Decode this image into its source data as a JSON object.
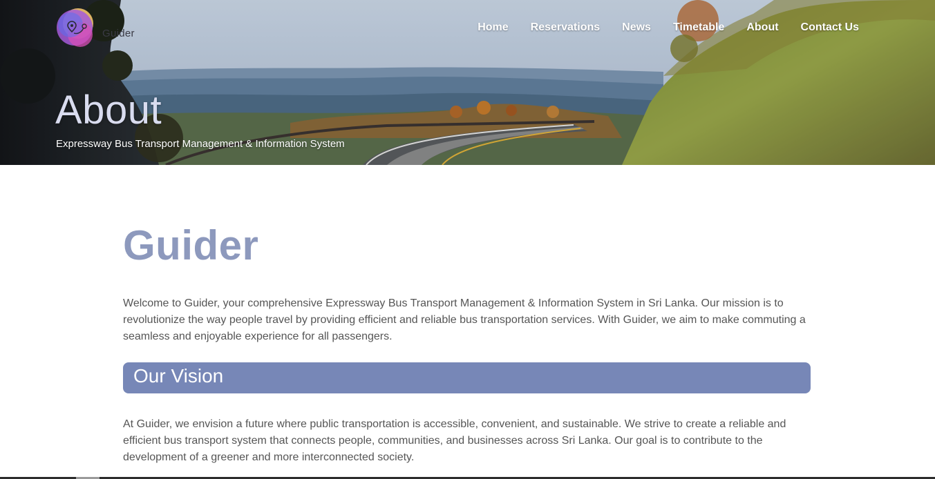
{
  "brand": {
    "logo_text": "Guider",
    "colors": {
      "heading": "#8d99bd",
      "vision_bar": "#7787b7",
      "body_text": "#555555"
    }
  },
  "nav": {
    "items": [
      {
        "label": "Home"
      },
      {
        "label": "Reservations"
      },
      {
        "label": "News"
      },
      {
        "label": "Timetable"
      },
      {
        "label": "About"
      },
      {
        "label": "Contact Us"
      }
    ]
  },
  "hero": {
    "title": "About",
    "subtitle": "Expressway Bus Transport Management & Information System",
    "image": "mountain-road-landscape"
  },
  "content": {
    "heading": "Guider",
    "intro": "Welcome to Guider, your comprehensive Expressway Bus Transport Management & Information System in Sri Lanka. Our mission is to revolutionize the way people travel by providing efficient and reliable bus transportation services. With Guider, we aim to make commuting a seamless and enjoyable experience for all passengers.",
    "vision_title": "Our Vision",
    "vision_text": "At Guider, we envision a future where public transportation is accessible, convenient, and sustainable. We strive to create a reliable and efficient bus transport system that connects people, communities, and businesses across Sri Lanka. Our goal is to contribute to the development of a greener and more interconnected society."
  }
}
